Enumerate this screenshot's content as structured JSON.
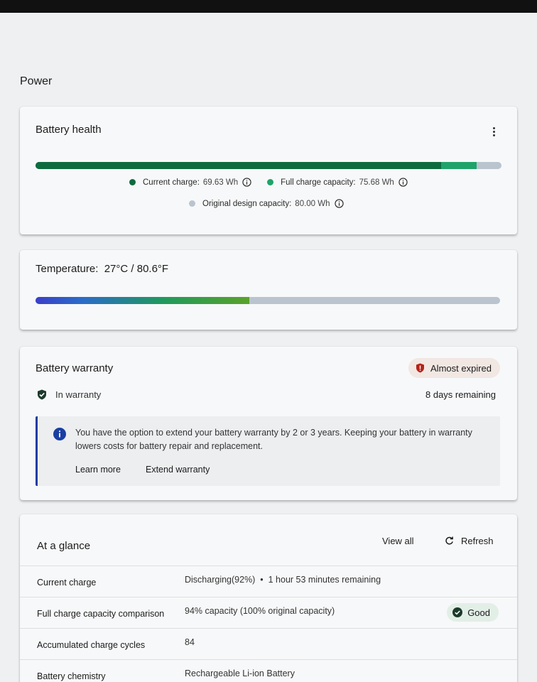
{
  "page": {
    "title": "Power"
  },
  "battery_health": {
    "title": "Battery health",
    "bar": {
      "current_charge_wh": 69.63,
      "full_charge_wh": 75.68,
      "design_wh": 80.0
    },
    "legend": {
      "current_label": "Current charge:",
      "current_value": "69.63 Wh",
      "full_label": "Full charge capacity:",
      "full_value": "75.68 Wh",
      "design_label": "Original design capacity:",
      "design_value": "80.00 Wh"
    },
    "colors": {
      "current": "#0d6b3f",
      "full": "#1fa36a",
      "design": "#b9c4cf"
    }
  },
  "temperature": {
    "label": "Temperature:",
    "value": "27°C / 80.6°F",
    "level_fraction": 0.46
  },
  "warranty": {
    "title": "Battery warranty",
    "status_badge": "Almost expired",
    "status_text": "In warranty",
    "remaining": "8 days remaining",
    "info_text": "You have the option to extend your battery warranty by 2 or 3 years. Keeping your battery in warranty lowers costs for battery repair and replacement.",
    "learn_more": "Learn more",
    "extend": "Extend warranty",
    "colors": {
      "alert": "#b42318",
      "accent": "#1a3ea3",
      "ok": "#1c3a2c"
    }
  },
  "glance": {
    "title": "At a glance",
    "view_all": "View all",
    "refresh": "Refresh",
    "rows": [
      {
        "key": "Current charge",
        "value": "Discharging(92%)  •  1 hour 53 minutes remaining"
      },
      {
        "key": "Full charge capacity comparison",
        "value": "94% capacity (100% original capacity)",
        "badge": "Good"
      },
      {
        "key": "Accumulated charge cycles",
        "value": "84"
      },
      {
        "key": "Battery chemistry",
        "value": "Rechargeable Li-ion Battery"
      }
    ]
  }
}
